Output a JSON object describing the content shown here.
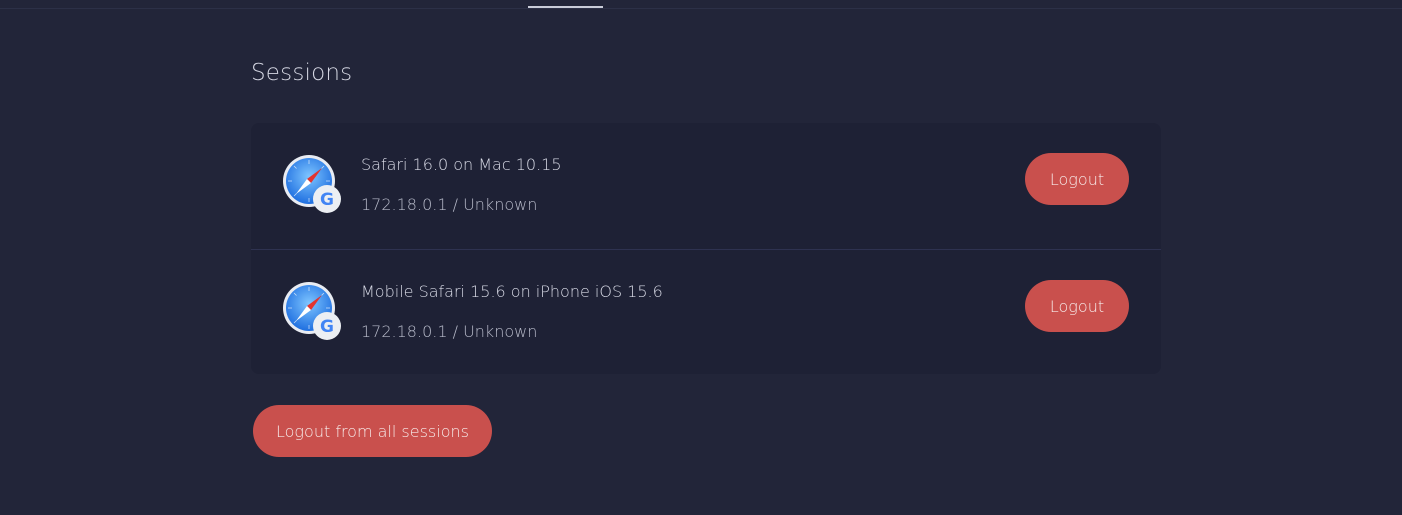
{
  "page": {
    "title": "Sessions"
  },
  "sessions": [
    {
      "name": "Safari 16.0 on Mac 10.15",
      "meta": "172.18.0.1 / Unknown",
      "logout_label": "Logout",
      "icon": "safari-icon",
      "badge_icon": "google-icon"
    },
    {
      "name": "Mobile Safari 15.6 on iPhone iOS 15.6",
      "meta": "172.18.0.1 / Unknown",
      "logout_label": "Logout",
      "icon": "safari-icon",
      "badge_icon": "google-icon"
    }
  ],
  "actions": {
    "logout_all_label": "Logout from all sessions"
  },
  "colors": {
    "background": "#222539",
    "card": "#1e2135",
    "danger_button": "#c9504d",
    "text": "#d8dae6"
  }
}
